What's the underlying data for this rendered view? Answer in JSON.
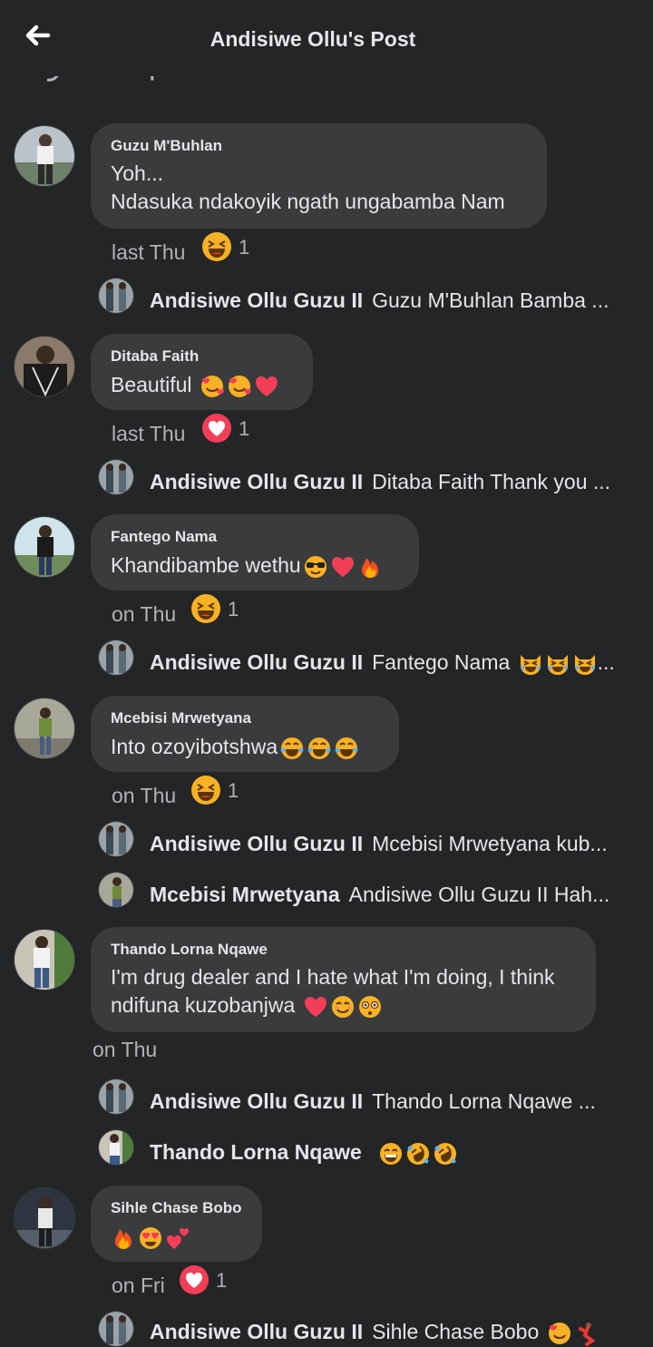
{
  "header": {
    "title": "Andisiwe Ollu's Post"
  },
  "previous_comments_label": "Show previous comments",
  "comments": [
    {
      "author": "Guzu  M'Buhlan",
      "line1": "Yoh...",
      "line2": "Ndasuka ndakoyik ngath ungabamba Nam",
      "time": "last Thu",
      "reaction": "laughing-emoji",
      "reaction_count": "1",
      "replies": [
        {
          "author": "Andisiwe Ollu Guzu II",
          "text": "Guzu  M'Buhlan Bamba ..."
        }
      ]
    },
    {
      "author": "Ditaba Faith",
      "line1": "Beautiful",
      "time": "last Thu",
      "reaction": "love-emoji",
      "reaction_count": "1",
      "replies": [
        {
          "author": "Andisiwe Ollu Guzu II",
          "text": "Ditaba Faith Thank you ..."
        }
      ]
    },
    {
      "author": "Fantego Nama",
      "line1": "Khandibambe wethu",
      "time": "on Thu",
      "reaction": "laughing-emoji",
      "reaction_count": "1",
      "replies": [
        {
          "author": "Andisiwe Ollu Guzu II",
          "text": "Fantego Nama",
          "suffix": "..."
        }
      ]
    },
    {
      "author": "Mcebisi Mrwetyana",
      "line1": "Into ozoyibotshwa",
      "time": "on Thu",
      "reaction": "laughing-emoji",
      "reaction_count": "1",
      "replies": [
        {
          "author": "Andisiwe Ollu Guzu II",
          "text": "Mcebisi Mrwetyana kub..."
        },
        {
          "author": "Mcebisi Mrwetyana",
          "text": "Andisiwe Ollu Guzu II Hah..."
        }
      ]
    },
    {
      "author": "Thando Lorna Nqawe",
      "line1": "I'm drug dealer and I hate what I'm doing, I think",
      "line2": "ndifuna kuzobanjwa",
      "time": "on Thu",
      "replies": [
        {
          "author": "Andisiwe Ollu Guzu II",
          "text": "Thando Lorna Nqawe ..."
        },
        {
          "author": "Thando Lorna Nqawe",
          "text": ""
        }
      ]
    },
    {
      "author": "Sihle Chase Bobo",
      "time": "on Fri",
      "reaction": "love-emoji",
      "reaction_count": "1",
      "replies": [
        {
          "author": "Andisiwe Ollu Guzu II",
          "text": "Sihle Chase Bobo"
        }
      ]
    }
  ],
  "colors": {
    "background": "#242526",
    "bubble": "#3a3b3c",
    "text": "#e4e6eb",
    "muted": "#b0b3b8",
    "heart": "#f33e58",
    "laugh": "#f7b125"
  }
}
